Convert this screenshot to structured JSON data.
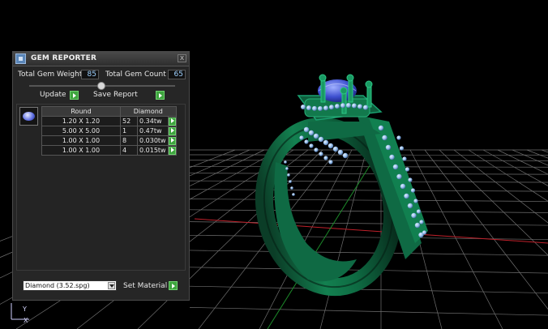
{
  "panel": {
    "title": "GEM REPORTER",
    "close_glyph": "x",
    "total_weight_label": "Total Gem Weight",
    "total_weight_value": "85",
    "total_count_label": "Total Gem Count",
    "total_count_value": "65",
    "update_label": "Update",
    "save_report_label": "Save Report",
    "table": {
      "headers": [
        "Round",
        "Diamond"
      ],
      "rows": [
        {
          "size": "1.20 X 1.20",
          "count": "52",
          "weight": "0.34tw"
        },
        {
          "size": "5.00 X 5.00",
          "count": "1",
          "weight": "0.47tw"
        },
        {
          "size": "1.00 X 1.00",
          "count": "8",
          "weight": "0.030tw"
        },
        {
          "size": "1.00 X 1.00",
          "count": "4",
          "weight": "0.015tw"
        }
      ]
    },
    "material_select_value": "Diamond      (3.52.spg)",
    "set_material_label": "Set Material"
  },
  "axis": {
    "y": "Y",
    "x": "X"
  },
  "colors": {
    "ring": "#0f5b3a",
    "gem": "#4f63d6",
    "grid": "#7a7a7a",
    "axis_red": "#c0202a",
    "axis_green": "#1c8a2a"
  }
}
